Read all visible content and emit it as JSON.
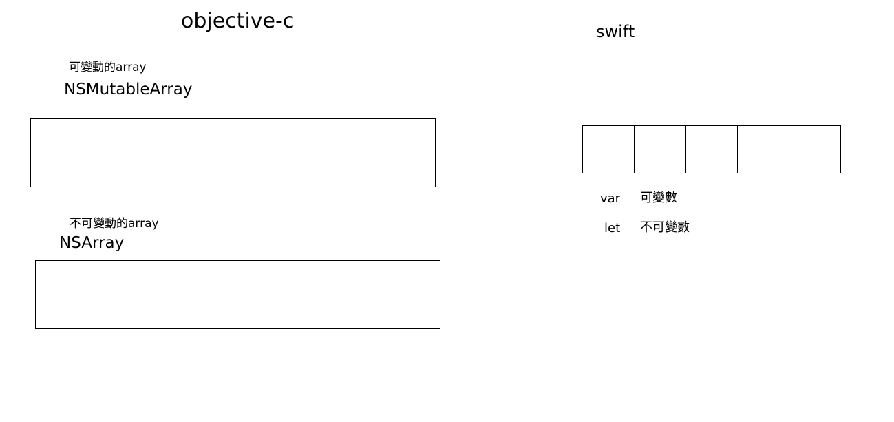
{
  "objc": {
    "title": "objective-c",
    "mutable_label": "可變動的array",
    "mutable_class": "NSMutableArray",
    "immutable_label": "不可變動的array",
    "immutable_class": "NSArray"
  },
  "swift": {
    "title": "swift",
    "cell_count": 5,
    "var_keyword": "var",
    "var_desc": "可變數",
    "let_keyword": "let",
    "let_desc": "不可變數"
  }
}
